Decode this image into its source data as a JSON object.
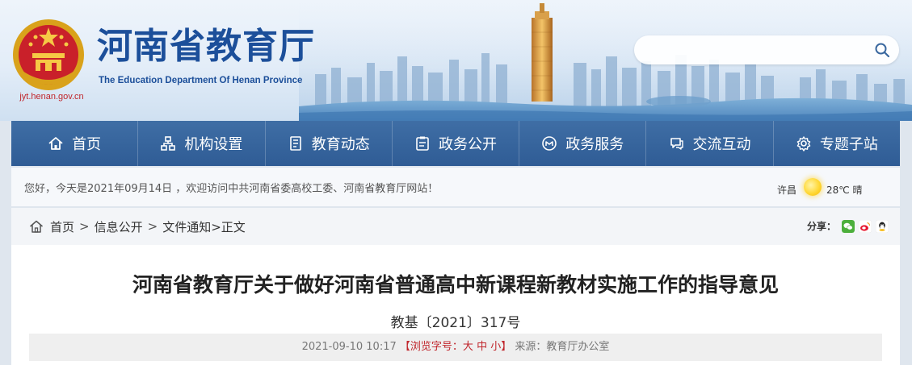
{
  "site": {
    "url": "jyt.henan.gov.cn",
    "title": "河南省教育厅",
    "title_en": "The Education Department Of Henan Province"
  },
  "search": {
    "placeholder": "",
    "value": ""
  },
  "nav": {
    "items": [
      {
        "label": "首页",
        "icon": "home-icon"
      },
      {
        "label": "机构设置",
        "icon": "org-chart-icon"
      },
      {
        "label": "教育动态",
        "icon": "document-icon"
      },
      {
        "label": "政务公开",
        "icon": "clipboard-icon"
      },
      {
        "label": "政务服务",
        "icon": "service-badge-icon"
      },
      {
        "label": "交流互动",
        "icon": "chat-icon"
      },
      {
        "label": "专题子站",
        "icon": "settings-icon"
      }
    ]
  },
  "welcome": {
    "text": "您好，今天是2021年09月14日 ，欢迎访问中共河南省委高校工委、河南省教育厅网站！",
    "weather_city": "许昌",
    "weather_temp": "28℃ 晴",
    "weather_icon": "sun-icon"
  },
  "breadcrumb": {
    "items": [
      "首页",
      "信息公开",
      "文件通知"
    ],
    "separator": ">",
    "current": ">正文"
  },
  "share": {
    "label": "分享：",
    "targets": [
      "wechat-icon",
      "weibo-icon",
      "qq-icon"
    ]
  },
  "article": {
    "title": "河南省教育厅关于做好河南省普通高中新课程新教材实施工作的指导意见",
    "doc_number": "教基〔2021〕317号",
    "date": "2021-09-10 10:17",
    "font_size_prefix": "【浏览字号：",
    "font_size_options": [
      "大",
      "中",
      "小"
    ],
    "font_size_suffix": "】",
    "source": "来源：教育厅办公室"
  },
  "colors": {
    "brand_blue": "#1c4f9a",
    "nav_blue": "#3a689f",
    "accent_red": "#c0262c"
  }
}
